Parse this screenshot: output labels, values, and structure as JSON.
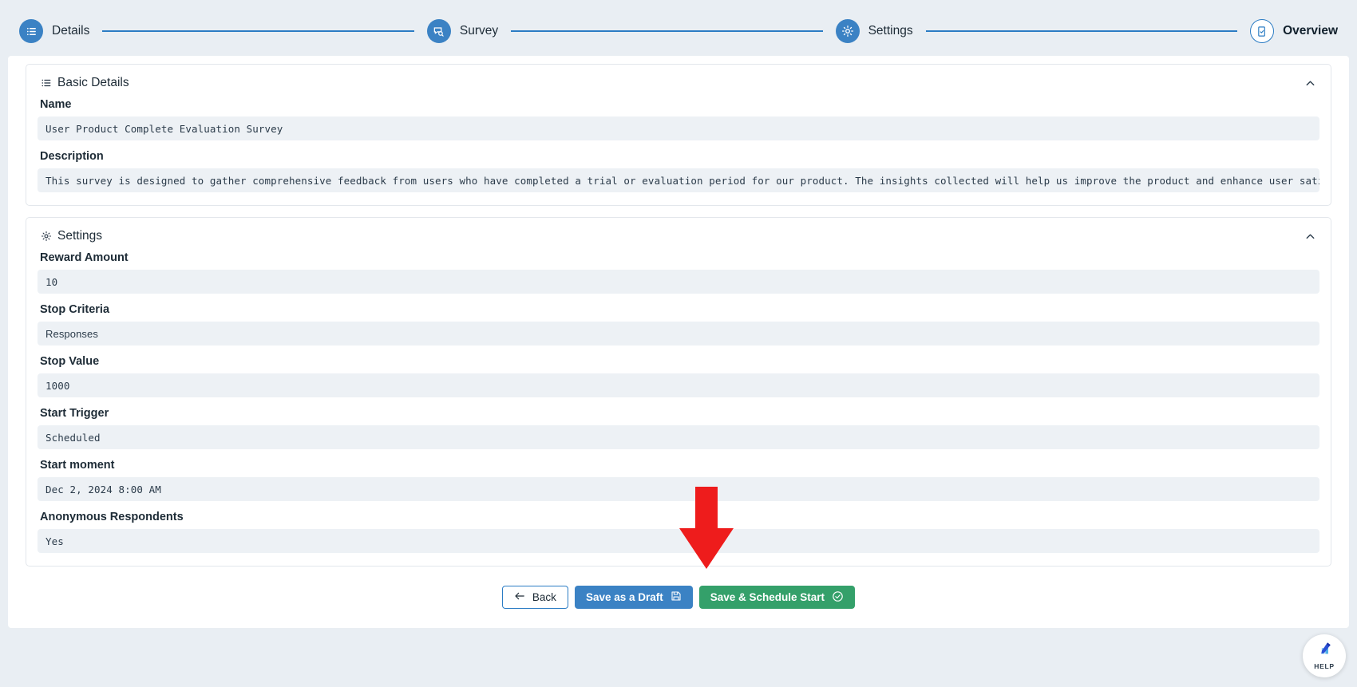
{
  "stepper": {
    "steps": [
      {
        "label": "Details",
        "icon": "list-icon",
        "state": "done"
      },
      {
        "label": "Survey",
        "icon": "survey-search-icon",
        "state": "done"
      },
      {
        "label": "Settings",
        "icon": "gear-icon",
        "state": "done"
      },
      {
        "label": "Overview",
        "icon": "document-check-icon",
        "state": "active"
      }
    ],
    "line_color": "#2b7cc4",
    "circle_color": "#3b82c4"
  },
  "basic_details": {
    "title": "Basic Details",
    "icon": "list-icon",
    "collapse_icon": "chevron-up-icon",
    "fields": [
      {
        "label": "Name",
        "value": "User Product Complete Evaluation Survey"
      },
      {
        "label": "Description",
        "value": "This survey is designed to gather comprehensive feedback from users who have completed a trial or evaluation period for our product. The insights collected will help us improve the product and enhance user satisfaction."
      }
    ]
  },
  "settings": {
    "title": "Settings",
    "icon": "gear-icon",
    "collapse_icon": "chevron-up-icon",
    "fields": [
      {
        "label": "Reward Amount",
        "value": "10"
      },
      {
        "label": "Stop Criteria",
        "value": "Responses"
      },
      {
        "label": "Stop Value",
        "value": "1000"
      },
      {
        "label": "Start Trigger",
        "value": "Scheduled"
      },
      {
        "label": "Start moment",
        "value": "Dec 2, 2024 8:00 AM"
      },
      {
        "label": "Anonymous Respondents",
        "value": "Yes"
      }
    ]
  },
  "footer": {
    "back_label": "Back",
    "back_icon": "arrow-left-icon",
    "draft_label": "Save as a Draft",
    "draft_icon": "save-disk-icon",
    "schedule_label": "Save & Schedule Start",
    "schedule_icon": "check-circle-icon",
    "primary_color": "#3b82c4",
    "success_color": "#34a06a"
  },
  "annotation": {
    "arrow_color": "#ee1c1c",
    "points_at": "Save & Schedule Start"
  },
  "help_widget": {
    "label": "HELP",
    "icon": "help-chart-icon"
  }
}
